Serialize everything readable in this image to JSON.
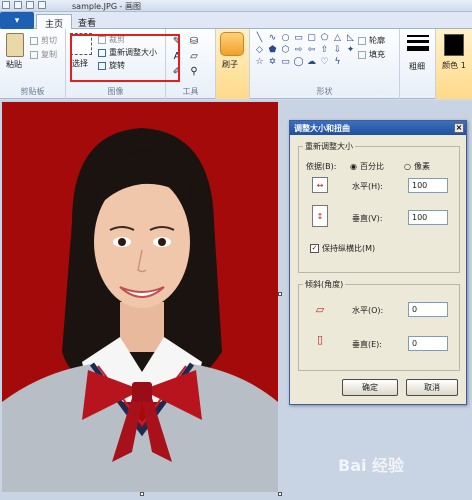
{
  "window": {
    "title": "sample.JPG - 画图"
  },
  "tabs": {
    "file": "▾",
    "home": "主页",
    "view": "查看"
  },
  "clipboard": {
    "paste": "粘贴",
    "cut": "剪切",
    "copy": "复制",
    "group": "剪贴板"
  },
  "image": {
    "select": "选择",
    "crop": "裁剪",
    "resize": "重新调整大小",
    "rotate": "旋转",
    "group": "图像"
  },
  "tools": {
    "group": "工具"
  },
  "brushes": {
    "label": "刷子"
  },
  "shapes": {
    "outline": "轮廓",
    "fill": "填充",
    "group": "形状"
  },
  "size": {
    "label": "粗细"
  },
  "color1": {
    "label": "颜色 1",
    "value": "#000000"
  },
  "dialog": {
    "title": "调整大小和扭曲",
    "resize_group": "重新调整大小",
    "by_label": "依据(B):",
    "percent": "百分比",
    "pixels": "像素",
    "horizontal_label": "水平(H):",
    "horizontal_value": "100",
    "vertical_label": "垂直(V):",
    "vertical_value": "100",
    "keep_ratio": "保持纵横比(M)",
    "skew_group": "倾斜(角度)",
    "skew_h_label": "水平(O):",
    "skew_h_value": "0",
    "skew_v_label": "垂直(E):",
    "skew_v_value": "0",
    "ok": "确定",
    "cancel": "取消"
  },
  "watermark": {
    "text": "Bai 经验"
  },
  "colors": {
    "accent": "#1d5fb3",
    "highlight": "#e02020",
    "photo_bg": "#a50a0a"
  }
}
